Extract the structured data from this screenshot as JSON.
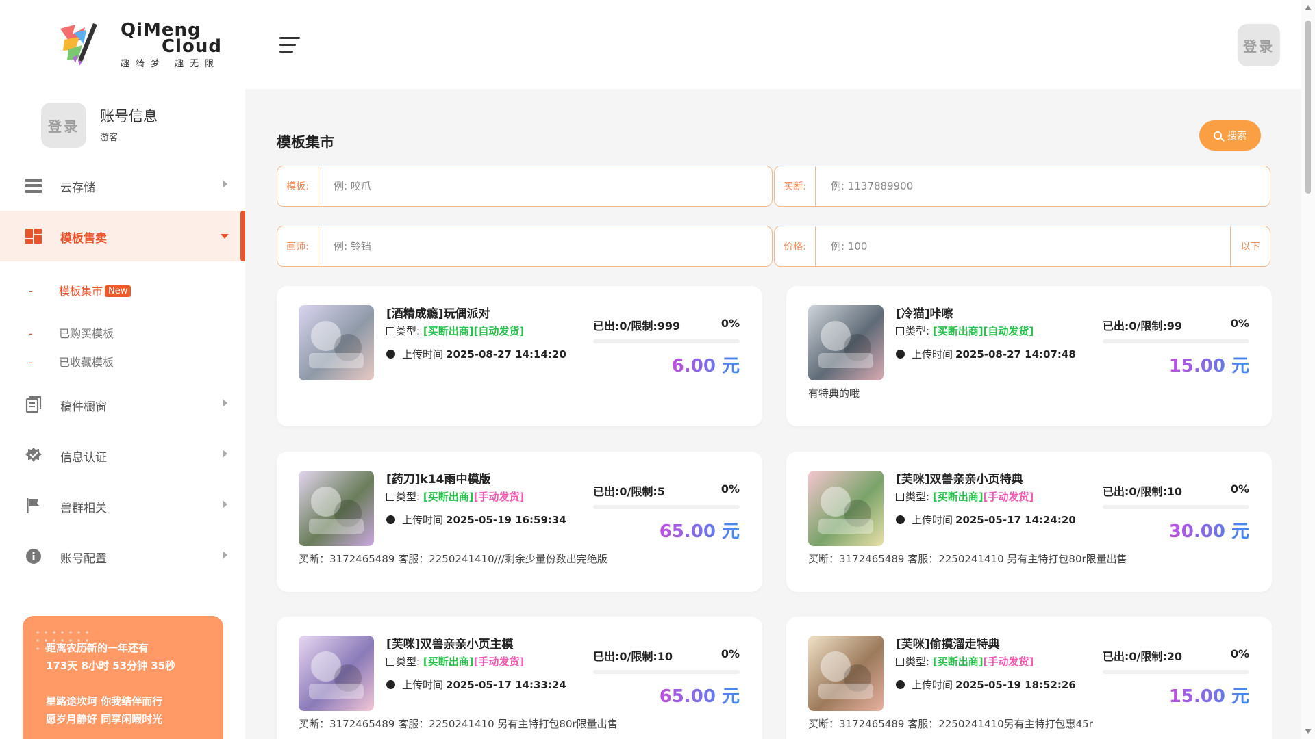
{
  "header": {
    "logo_en_line1": "QiMeng",
    "logo_en_line2": "Cloud",
    "logo_cn": "趣绮梦 趣无限",
    "login_label": "登录"
  },
  "account": {
    "avatar_label": "登录",
    "title": "账号信息",
    "role": "游客"
  },
  "sidebar": {
    "items": [
      {
        "label": "云存储",
        "icon": "server-icon"
      },
      {
        "label": "模板售卖",
        "icon": "dashboard-icon"
      },
      {
        "label": "稿件橱窗",
        "icon": "document-icon"
      },
      {
        "label": "信息认证",
        "icon": "verified-icon"
      },
      {
        "label": "兽群相关",
        "icon": "flag-icon"
      },
      {
        "label": "账号配置",
        "icon": "info-icon"
      }
    ],
    "subitems": [
      {
        "label": "模板集市",
        "badge": "New"
      },
      {
        "label": "已购买模板"
      },
      {
        "label": "已收藏模板"
      }
    ]
  },
  "promo": {
    "line1": "距离农历新的一年还有",
    "line2": "173天 8小时 53分钟 35秒",
    "line3": "星路途坎坷 你我结伴而行",
    "line4": "愿岁月静好 同享闲暇时光"
  },
  "main": {
    "title": "模板集市",
    "search_label": "搜索",
    "filters": {
      "template": {
        "label": "模板:",
        "placeholder": "例: 咬爪"
      },
      "buyout": {
        "label": "买断:",
        "placeholder": "例: 1137889900"
      },
      "artist": {
        "label": "画师:",
        "placeholder": "例: 铃铛"
      },
      "price": {
        "label": "价格:",
        "placeholder": "例: 100",
        "suffix": "以下"
      }
    }
  },
  "cards": [
    {
      "title": "[酒精成瘾]玩偶派对",
      "type_prefix": "类型:",
      "tag1": "[买断出商]",
      "tag2": "[自动发货]",
      "tag2_color": "#27c24c",
      "time_label": "上传时间",
      "time": "2025-08-27 14:14:20",
      "sold": "已出:0/限制:999",
      "percent": "0%",
      "progress": 0,
      "price": "6.00 元",
      "desc": "",
      "thumb_colors": [
        "#d9d4ef",
        "#8f9aa8",
        "#e8c9c3"
      ]
    },
    {
      "title": "[冷猫]咔嚓",
      "type_prefix": "类型:",
      "tag1": "[买断出商]",
      "tag2": "[自动发货]",
      "tag2_color": "#27c24c",
      "time_label": "上传时间",
      "time": "2025-08-27 14:07:48",
      "sold": "已出:0/限制:99",
      "percent": "0%",
      "progress": 0,
      "price": "15.00 元",
      "desc": "有特典的哦",
      "thumb_colors": [
        "#cfd4da",
        "#5f6b77",
        "#d9aab2"
      ]
    },
    {
      "title": "[药刀]k14雨中模版",
      "type_prefix": "类型:",
      "tag1": "[买断出商]",
      "tag2": "[手动发货]",
      "tag2_color": "#f25ab3",
      "time_label": "上传时间",
      "time": "2025-05-19 16:59:34",
      "sold": "已出:0/限制:5",
      "percent": "0%",
      "progress": 0,
      "price": "65.00 元",
      "desc": "买断：3172465489 客服：2250241410///剩余少量份数出完绝版",
      "thumb_colors": [
        "#e3d6ef",
        "#6a7d5a",
        "#c9a7e0"
      ]
    },
    {
      "title": "[芙咪]双兽亲亲小页特典",
      "type_prefix": "类型:",
      "tag1": "[买断出商]",
      "tag2": "[手动发货]",
      "tag2_color": "#f25ab3",
      "time_label": "上传时间",
      "time": "2025-05-17 14:24:20",
      "sold": "已出:0/限制:10",
      "percent": "0%",
      "progress": 0,
      "price": "30.00 元",
      "desc": "买断：3172465489 客服：2250241410 另有主特打包80r限量出售",
      "thumb_colors": [
        "#f5c6cf",
        "#7aa36a",
        "#e8e0a8"
      ]
    },
    {
      "title": "[芙咪]双兽亲亲小页主模",
      "type_prefix": "类型:",
      "tag1": "[买断出商]",
      "tag2": "[手动发货]",
      "tag2_color": "#f25ab3",
      "time_label": "上传时间",
      "time": "2025-05-17 14:33:24",
      "sold": "已出:0/限制:10",
      "percent": "0%",
      "progress": 0,
      "price": "65.00 元",
      "desc": "买断：3172465489 客服：2250241410 另有主特打包80r限量出售",
      "thumb_colors": [
        "#e8d8f2",
        "#8a7ab8",
        "#f2c7d6"
      ]
    },
    {
      "title": "[芙咪]偷摸溜走特典",
      "type_prefix": "类型:",
      "tag1": "[买断出商]",
      "tag2": "[手动发货]",
      "tag2_color": "#f25ab3",
      "time_label": "上传时间",
      "time": "2025-05-19 18:52:26",
      "sold": "已出:0/限制:20",
      "percent": "0%",
      "progress": 0,
      "price": "15.00 元",
      "desc": "买断：3172465489 客服：2250241410另有主特打包惠45r",
      "thumb_colors": [
        "#f0e2c8",
        "#9c7a5c",
        "#e6b0a0"
      ]
    }
  ]
}
